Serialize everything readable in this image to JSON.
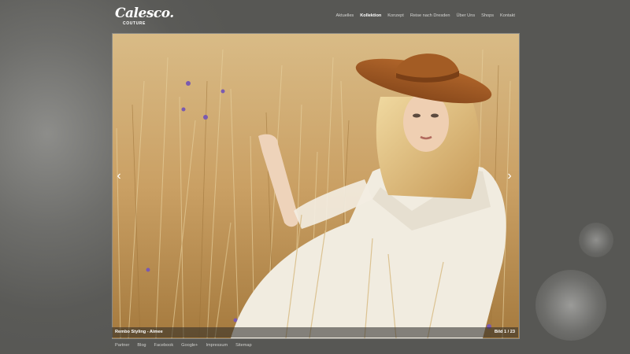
{
  "brand": {
    "logo_script": "Calesco.",
    "logo_sub": "COUTURE"
  },
  "nav": {
    "items": [
      {
        "label": "Aktuelles",
        "active": false
      },
      {
        "label": "Kollektion",
        "active": true
      },
      {
        "label": "Konzept",
        "active": false
      },
      {
        "label": "Reise nach Dresden",
        "active": false
      },
      {
        "label": "Über Uns",
        "active": false
      },
      {
        "label": "Shops",
        "active": false
      },
      {
        "label": "Kontakt",
        "active": false
      }
    ]
  },
  "gallery": {
    "caption": "Rembo Styling - Aimee",
    "counter": "Bild 1 / 23",
    "prev_icon": "chevron-left-icon",
    "next_icon": "chevron-right-icon"
  },
  "footer": {
    "links": [
      "Partner",
      "Blog",
      "Facebook",
      "Google+",
      "Impressum",
      "Sitemap"
    ]
  },
  "colors": {
    "background": "#575754",
    "nav_active": "#ffffff",
    "nav_text": "#d6d6d4"
  }
}
